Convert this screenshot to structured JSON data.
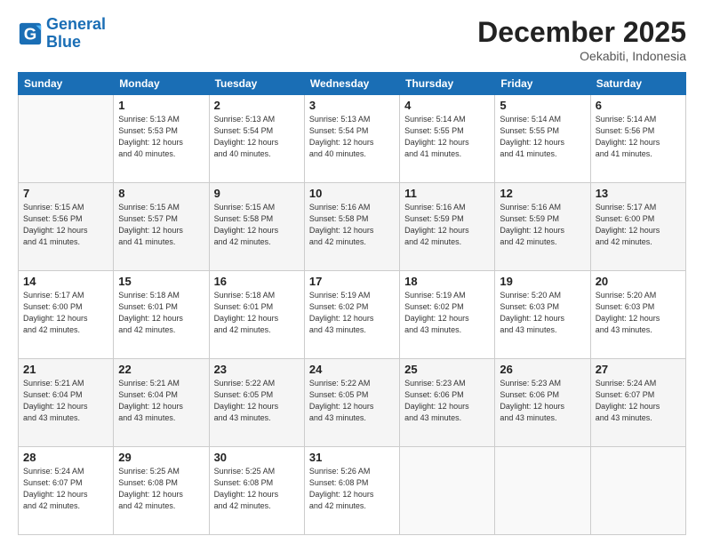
{
  "header": {
    "logo_line1": "General",
    "logo_line2": "Blue",
    "month": "December 2025",
    "location": "Oekabiti, Indonesia"
  },
  "columns": [
    "Sunday",
    "Monday",
    "Tuesday",
    "Wednesday",
    "Thursday",
    "Friday",
    "Saturday"
  ],
  "weeks": [
    [
      {
        "day": "",
        "info": ""
      },
      {
        "day": "1",
        "info": "Sunrise: 5:13 AM\nSunset: 5:53 PM\nDaylight: 12 hours\nand 40 minutes."
      },
      {
        "day": "2",
        "info": "Sunrise: 5:13 AM\nSunset: 5:54 PM\nDaylight: 12 hours\nand 40 minutes."
      },
      {
        "day": "3",
        "info": "Sunrise: 5:13 AM\nSunset: 5:54 PM\nDaylight: 12 hours\nand 40 minutes."
      },
      {
        "day": "4",
        "info": "Sunrise: 5:14 AM\nSunset: 5:55 PM\nDaylight: 12 hours\nand 41 minutes."
      },
      {
        "day": "5",
        "info": "Sunrise: 5:14 AM\nSunset: 5:55 PM\nDaylight: 12 hours\nand 41 minutes."
      },
      {
        "day": "6",
        "info": "Sunrise: 5:14 AM\nSunset: 5:56 PM\nDaylight: 12 hours\nand 41 minutes."
      }
    ],
    [
      {
        "day": "7",
        "info": "Sunrise: 5:15 AM\nSunset: 5:56 PM\nDaylight: 12 hours\nand 41 minutes."
      },
      {
        "day": "8",
        "info": "Sunrise: 5:15 AM\nSunset: 5:57 PM\nDaylight: 12 hours\nand 41 minutes."
      },
      {
        "day": "9",
        "info": "Sunrise: 5:15 AM\nSunset: 5:58 PM\nDaylight: 12 hours\nand 42 minutes."
      },
      {
        "day": "10",
        "info": "Sunrise: 5:16 AM\nSunset: 5:58 PM\nDaylight: 12 hours\nand 42 minutes."
      },
      {
        "day": "11",
        "info": "Sunrise: 5:16 AM\nSunset: 5:59 PM\nDaylight: 12 hours\nand 42 minutes."
      },
      {
        "day": "12",
        "info": "Sunrise: 5:16 AM\nSunset: 5:59 PM\nDaylight: 12 hours\nand 42 minutes."
      },
      {
        "day": "13",
        "info": "Sunrise: 5:17 AM\nSunset: 6:00 PM\nDaylight: 12 hours\nand 42 minutes."
      }
    ],
    [
      {
        "day": "14",
        "info": "Sunrise: 5:17 AM\nSunset: 6:00 PM\nDaylight: 12 hours\nand 42 minutes."
      },
      {
        "day": "15",
        "info": "Sunrise: 5:18 AM\nSunset: 6:01 PM\nDaylight: 12 hours\nand 42 minutes."
      },
      {
        "day": "16",
        "info": "Sunrise: 5:18 AM\nSunset: 6:01 PM\nDaylight: 12 hours\nand 42 minutes."
      },
      {
        "day": "17",
        "info": "Sunrise: 5:19 AM\nSunset: 6:02 PM\nDaylight: 12 hours\nand 43 minutes."
      },
      {
        "day": "18",
        "info": "Sunrise: 5:19 AM\nSunset: 6:02 PM\nDaylight: 12 hours\nand 43 minutes."
      },
      {
        "day": "19",
        "info": "Sunrise: 5:20 AM\nSunset: 6:03 PM\nDaylight: 12 hours\nand 43 minutes."
      },
      {
        "day": "20",
        "info": "Sunrise: 5:20 AM\nSunset: 6:03 PM\nDaylight: 12 hours\nand 43 minutes."
      }
    ],
    [
      {
        "day": "21",
        "info": "Sunrise: 5:21 AM\nSunset: 6:04 PM\nDaylight: 12 hours\nand 43 minutes."
      },
      {
        "day": "22",
        "info": "Sunrise: 5:21 AM\nSunset: 6:04 PM\nDaylight: 12 hours\nand 43 minutes."
      },
      {
        "day": "23",
        "info": "Sunrise: 5:22 AM\nSunset: 6:05 PM\nDaylight: 12 hours\nand 43 minutes."
      },
      {
        "day": "24",
        "info": "Sunrise: 5:22 AM\nSunset: 6:05 PM\nDaylight: 12 hours\nand 43 minutes."
      },
      {
        "day": "25",
        "info": "Sunrise: 5:23 AM\nSunset: 6:06 PM\nDaylight: 12 hours\nand 43 minutes."
      },
      {
        "day": "26",
        "info": "Sunrise: 5:23 AM\nSunset: 6:06 PM\nDaylight: 12 hours\nand 43 minutes."
      },
      {
        "day": "27",
        "info": "Sunrise: 5:24 AM\nSunset: 6:07 PM\nDaylight: 12 hours\nand 43 minutes."
      }
    ],
    [
      {
        "day": "28",
        "info": "Sunrise: 5:24 AM\nSunset: 6:07 PM\nDaylight: 12 hours\nand 42 minutes."
      },
      {
        "day": "29",
        "info": "Sunrise: 5:25 AM\nSunset: 6:08 PM\nDaylight: 12 hours\nand 42 minutes."
      },
      {
        "day": "30",
        "info": "Sunrise: 5:25 AM\nSunset: 6:08 PM\nDaylight: 12 hours\nand 42 minutes."
      },
      {
        "day": "31",
        "info": "Sunrise: 5:26 AM\nSunset: 6:08 PM\nDaylight: 12 hours\nand 42 minutes."
      },
      {
        "day": "",
        "info": ""
      },
      {
        "day": "",
        "info": ""
      },
      {
        "day": "",
        "info": ""
      }
    ]
  ]
}
